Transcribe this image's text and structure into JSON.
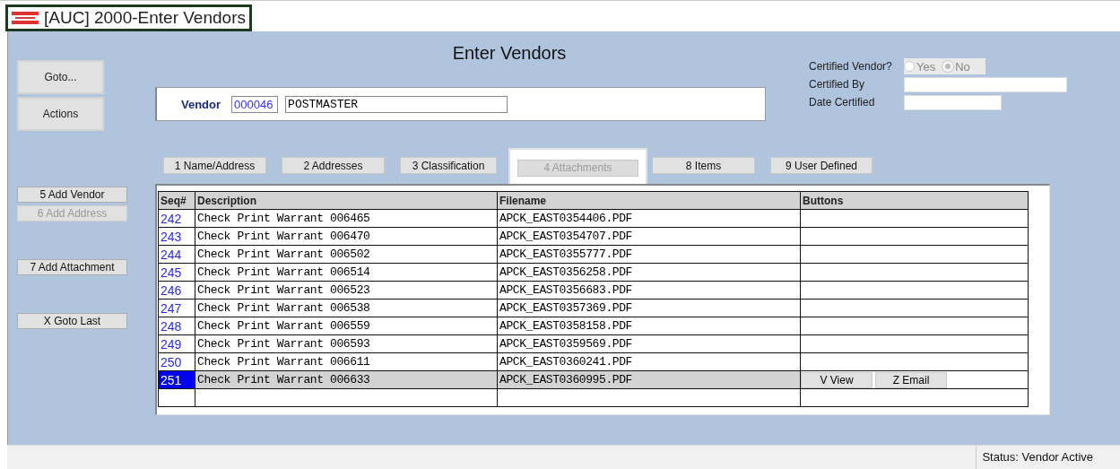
{
  "window": {
    "title": "[AUC] 2000-Enter Vendors"
  },
  "form_title": "Enter Vendors",
  "side_buttons_top": [
    {
      "label": "Goto..."
    },
    {
      "label": "Actions"
    }
  ],
  "vendor": {
    "label": "Vendor",
    "number": "000046",
    "name": "POSTMASTER"
  },
  "certified": {
    "label": "Certified Vendor?",
    "disabled": true,
    "options": [
      {
        "label": "Yes",
        "selected": false
      },
      {
        "label": "No",
        "selected": true
      }
    ],
    "by_label": "Certified By",
    "date_label": "Date Certified"
  },
  "side_button_groups": [
    [
      {
        "label": "5 Add Vendor",
        "disabled": false
      },
      {
        "label": "6 Add Address",
        "disabled": true
      }
    ],
    [
      {
        "label": "7 Add Attachment",
        "disabled": false
      }
    ],
    [
      {
        "label": "X Goto Last",
        "disabled": false
      }
    ]
  ],
  "tabs": [
    {
      "label": "1 Name/Address",
      "selected": false
    },
    {
      "label": "2 Addresses",
      "selected": false
    },
    {
      "label": "3 Classification",
      "selected": false
    },
    {
      "label": "4 Attachments",
      "selected": true
    },
    {
      "label": "8 Items",
      "selected": false
    },
    {
      "label": "9 User Defined",
      "selected": false
    }
  ],
  "table": {
    "columns": [
      "Seq#",
      "Description",
      "Filename",
      "Buttons"
    ],
    "rows": [
      {
        "seq": "242",
        "description": "Check Print Warrant 006465",
        "filename": "APCK_EAST0354406.PDF",
        "selected": false
      },
      {
        "seq": "243",
        "description": "Check Print Warrant 006470",
        "filename": "APCK_EAST0354707.PDF",
        "selected": false
      },
      {
        "seq": "244",
        "description": "Check Print Warrant 006502",
        "filename": "APCK_EAST0355777.PDF",
        "selected": false
      },
      {
        "seq": "245",
        "description": "Check Print Warrant 006514",
        "filename": "APCK_EAST0356258.PDF",
        "selected": false
      },
      {
        "seq": "246",
        "description": "Check Print Warrant 006523",
        "filename": "APCK_EAST0356683.PDF",
        "selected": false
      },
      {
        "seq": "247",
        "description": "Check Print Warrant 006538",
        "filename": "APCK_EAST0357369.PDF",
        "selected": false
      },
      {
        "seq": "248",
        "description": "Check Print Warrant 006559",
        "filename": "APCK_EAST0358158.PDF",
        "selected": false
      },
      {
        "seq": "249",
        "description": "Check Print Warrant 006593",
        "filename": "APCK_EAST0359569.PDF",
        "selected": false
      },
      {
        "seq": "250",
        "description": "Check Print Warrant 006611",
        "filename": "APCK_EAST0360241.PDF",
        "selected": false
      },
      {
        "seq": "251",
        "description": "Check Print Warrant 006633",
        "filename": "APCK_EAST0360995.PDF",
        "selected": true,
        "buttons": [
          "V View",
          "Z Email"
        ]
      }
    ]
  },
  "status_bar": "Status: Vendor Active"
}
